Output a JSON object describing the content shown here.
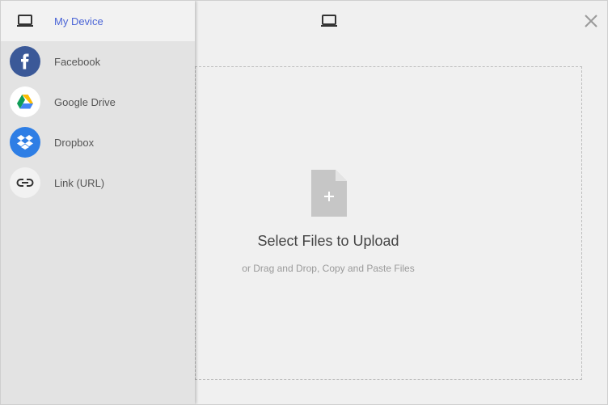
{
  "sidebar": {
    "items": [
      {
        "label": "My Device",
        "icon": "laptop-icon",
        "active": true
      },
      {
        "label": "Facebook",
        "icon": "facebook-icon",
        "color": "#3b5998"
      },
      {
        "label": "Google Drive",
        "icon": "google-drive-icon",
        "color": "#ffffff"
      },
      {
        "label": "Dropbox",
        "icon": "dropbox-icon",
        "color": "#2e7ee5"
      },
      {
        "label": "Link (URL)",
        "icon": "link-icon",
        "color": "#f2f2f2"
      }
    ]
  },
  "header": {
    "device_icon": "laptop-icon",
    "close_icon": "close-icon"
  },
  "dropzone": {
    "title": "Select Files to Upload",
    "subtitle": "or Drag and Drop, Copy and Paste Files",
    "icon": "add-file-icon"
  },
  "colors": {
    "accent": "#4a64d6",
    "facebook": "#3b5998",
    "dropbox": "#2e7ee5"
  }
}
